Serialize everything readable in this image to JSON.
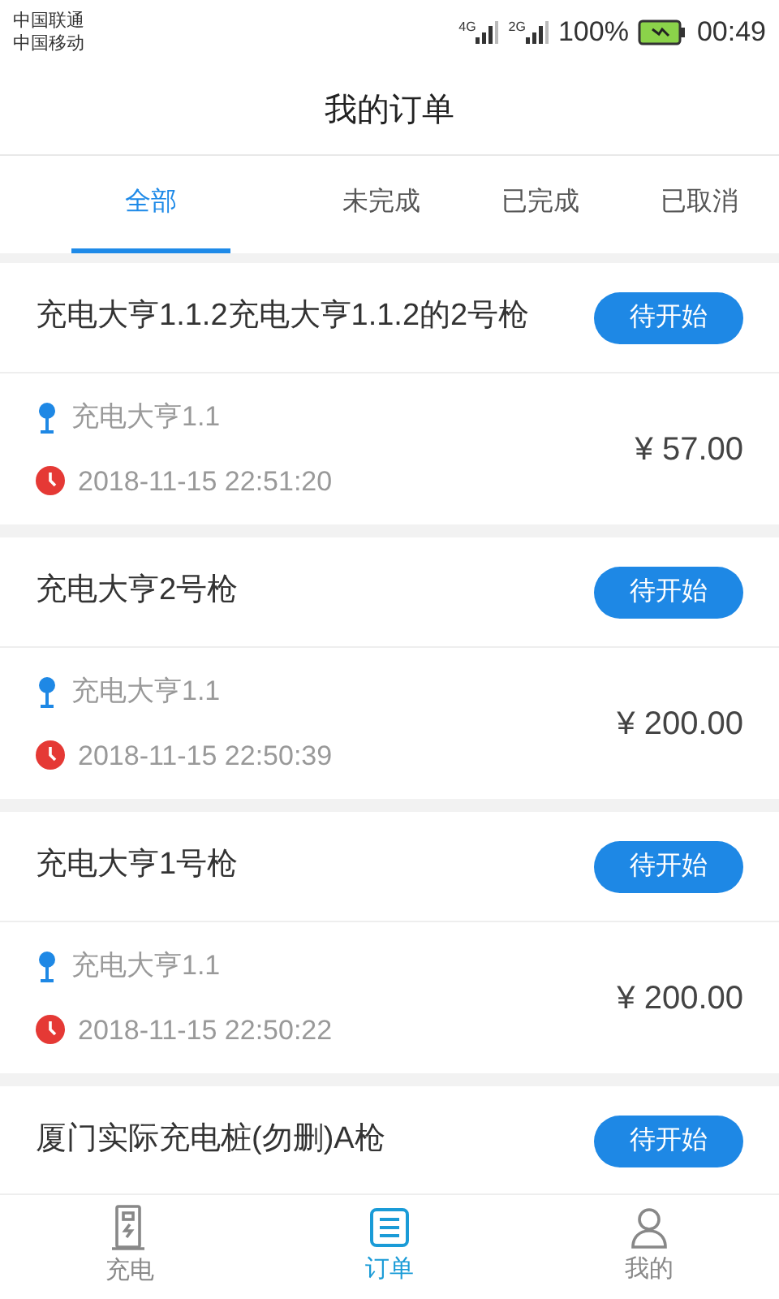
{
  "status_bar": {
    "carriers": [
      "中国联通",
      "中国移动"
    ],
    "networks": [
      "4G",
      "2G"
    ],
    "battery": "100%",
    "time": "00:49"
  },
  "header": {
    "title": "我的订单"
  },
  "tabs": [
    {
      "label": "全部",
      "selected": true
    },
    {
      "label": "未完成",
      "selected": false
    },
    {
      "label": "已完成",
      "selected": false
    },
    {
      "label": "已取消",
      "selected": false
    }
  ],
  "orders": [
    {
      "title": "充电大亨1.1.2充电大亨1.1.2的2号枪",
      "status": "待开始",
      "station": "充电大亨1.1",
      "time": "2018-11-15 22:51:20",
      "price": "¥ 57.00"
    },
    {
      "title": "充电大亨2号枪",
      "status": "待开始",
      "station": "充电大亨1.1",
      "time": "2018-11-15 22:50:39",
      "price": "¥ 200.00"
    },
    {
      "title": "充电大亨1号枪",
      "status": "待开始",
      "station": "充电大亨1.1",
      "time": "2018-11-15 22:50:22",
      "price": "¥ 200.00"
    },
    {
      "title": "厦门实际充电桩(勿删)A枪",
      "status": "待开始"
    }
  ],
  "bottom_nav": [
    {
      "label": "充电",
      "kind": "charger",
      "selected": false
    },
    {
      "label": "订单",
      "kind": "orders",
      "selected": true
    },
    {
      "label": "我的",
      "kind": "profile",
      "selected": false
    }
  ]
}
